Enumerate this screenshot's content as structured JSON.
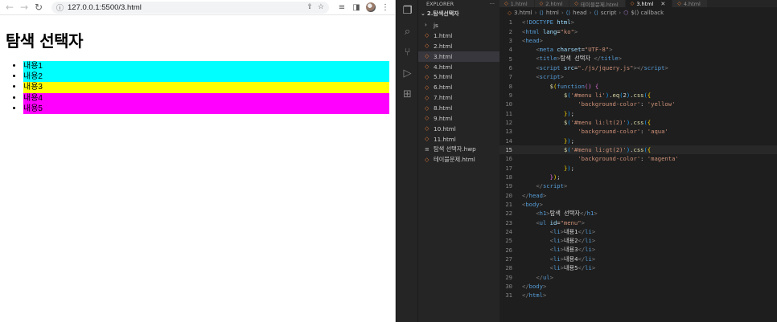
{
  "browser": {
    "url": "127.0.0.1:5500/3.html",
    "heading": "탐색 선택자",
    "items": [
      {
        "label": "내용1",
        "bg": "#00ffff"
      },
      {
        "label": "내용2",
        "bg": "#00ffff"
      },
      {
        "label": "내용3",
        "bg": "#ffff00"
      },
      {
        "label": "내용4",
        "bg": "#ff00ff"
      },
      {
        "label": "내용5",
        "bg": "#ff00ff"
      }
    ]
  },
  "explorer": {
    "header": "EXPLORER",
    "more": "···",
    "folder": "2.탐색선택자",
    "items": [
      {
        "label": "js",
        "kind": "dir"
      },
      {
        "label": "1.html",
        "kind": "html"
      },
      {
        "label": "2.html",
        "kind": "html"
      },
      {
        "label": "3.html",
        "kind": "html",
        "selected": true
      },
      {
        "label": "4.html",
        "kind": "html"
      },
      {
        "label": "5.html",
        "kind": "html"
      },
      {
        "label": "6.html",
        "kind": "html"
      },
      {
        "label": "7.html",
        "kind": "html"
      },
      {
        "label": "8.html",
        "kind": "html"
      },
      {
        "label": "9.html",
        "kind": "html"
      },
      {
        "label": "10.html",
        "kind": "html"
      },
      {
        "label": "11.html",
        "kind": "html"
      },
      {
        "label": "탐색 선택자.hwp",
        "kind": "txt"
      },
      {
        "label": "테이블문제.html",
        "kind": "html"
      }
    ]
  },
  "tabs": [
    {
      "label": "1.html",
      "active": false
    },
    {
      "label": "2.html",
      "active": false
    },
    {
      "label": "테이블문제.html",
      "active": false
    },
    {
      "label": "3.html",
      "active": true
    },
    {
      "label": "4.html",
      "active": false
    }
  ],
  "breadcrumb": [
    "3.html",
    "html",
    "head",
    "script",
    "$() callback"
  ],
  "code": [
    [
      [
        "t-brk",
        "<!"
      ],
      [
        "t-dt",
        "DOCTYPE"
      ],
      [
        "t-txt",
        " "
      ],
      [
        "t-attr",
        "html"
      ],
      [
        "t-brk",
        ">"
      ]
    ],
    [
      [
        "t-brk",
        "<"
      ],
      [
        "t-tag",
        "html"
      ],
      [
        "t-txt",
        " "
      ],
      [
        "t-attr",
        "lang"
      ],
      [
        "t-txt",
        "="
      ],
      [
        "t-str",
        "\"ko\""
      ],
      [
        "t-brk",
        ">"
      ]
    ],
    [
      [
        "t-brk",
        "<"
      ],
      [
        "t-tag",
        "head"
      ],
      [
        "t-brk",
        ">"
      ]
    ],
    [
      [
        "t-txt",
        "    "
      ],
      [
        "t-brk",
        "<"
      ],
      [
        "t-tag",
        "meta"
      ],
      [
        "t-txt",
        " "
      ],
      [
        "t-attr",
        "charset"
      ],
      [
        "t-txt",
        "="
      ],
      [
        "t-str",
        "\"UTF-8\""
      ],
      [
        "t-brk",
        ">"
      ]
    ],
    [
      [
        "t-txt",
        "    "
      ],
      [
        "t-brk",
        "<"
      ],
      [
        "t-tag",
        "title"
      ],
      [
        "t-brk",
        ">"
      ],
      [
        "t-txt",
        "탐색 선택자 "
      ],
      [
        "t-brk",
        "</"
      ],
      [
        "t-tag",
        "title"
      ],
      [
        "t-brk",
        ">"
      ]
    ],
    [
      [
        "t-txt",
        "    "
      ],
      [
        "t-brk",
        "<"
      ],
      [
        "t-tag",
        "script"
      ],
      [
        "t-txt",
        " "
      ],
      [
        "t-attr",
        "src"
      ],
      [
        "t-txt",
        "="
      ],
      [
        "t-str",
        "\"./js/jquery.js\""
      ],
      [
        "t-brk",
        "></"
      ],
      [
        "t-tag",
        "script"
      ],
      [
        "t-brk",
        ">"
      ]
    ],
    [
      [
        "t-txt",
        "    "
      ],
      [
        "t-brk",
        "<"
      ],
      [
        "t-tag",
        "script"
      ],
      [
        "t-brk",
        ">"
      ]
    ],
    [
      [
        "t-txt",
        "        "
      ],
      [
        "t-fn",
        "$"
      ],
      [
        "t-y",
        "("
      ],
      [
        "t-tag",
        "function"
      ],
      [
        "t-p",
        "()"
      ],
      [
        "t-txt",
        " "
      ],
      [
        "t-p",
        "{"
      ]
    ],
    [
      [
        "t-txt",
        "            "
      ],
      [
        "t-fn",
        "$"
      ],
      [
        "t-b",
        "("
      ],
      [
        "t-str",
        "'#menu li'"
      ],
      [
        "t-b",
        ")"
      ],
      [
        "t-txt",
        "."
      ],
      [
        "t-fn",
        "eq"
      ],
      [
        "t-b",
        "("
      ],
      [
        "t-txt",
        "2"
      ],
      [
        "t-b",
        ")"
      ],
      [
        "t-txt",
        "."
      ],
      [
        "t-fn",
        "css"
      ],
      [
        "t-b",
        "("
      ],
      [
        "t-y",
        "{"
      ]
    ],
    [
      [
        "t-txt",
        "                "
      ],
      [
        "t-str",
        "'background-color'"
      ],
      [
        "t-txt",
        ": "
      ],
      [
        "t-str",
        "'yellow'"
      ]
    ],
    [
      [
        "t-txt",
        "            "
      ],
      [
        "t-y",
        "}"
      ],
      [
        "t-b",
        ")"
      ],
      [
        "t-txt",
        ";"
      ]
    ],
    [
      [
        "t-txt",
        "            "
      ],
      [
        "t-fn",
        "$"
      ],
      [
        "t-b",
        "("
      ],
      [
        "t-str",
        "'#menu li:lt(2)'"
      ],
      [
        "t-b",
        ")"
      ],
      [
        "t-txt",
        "."
      ],
      [
        "t-fn",
        "css"
      ],
      [
        "t-b",
        "("
      ],
      [
        "t-y",
        "{"
      ]
    ],
    [
      [
        "t-txt",
        "                "
      ],
      [
        "t-str",
        "'background-color'"
      ],
      [
        "t-txt",
        ": "
      ],
      [
        "t-str",
        "'aqua'"
      ]
    ],
    [
      [
        "t-txt",
        "            "
      ],
      [
        "t-y",
        "}"
      ],
      [
        "t-b",
        ")"
      ],
      [
        "t-txt",
        ";"
      ]
    ],
    [
      [
        "t-txt",
        "            "
      ],
      [
        "t-fn",
        "$"
      ],
      [
        "t-b",
        "("
      ],
      [
        "t-str",
        "'#menu li:gt(2)'"
      ],
      [
        "t-b",
        ")"
      ],
      [
        "t-txt",
        "."
      ],
      [
        "t-fn",
        "css"
      ],
      [
        "t-b",
        "("
      ],
      [
        "t-y",
        "{"
      ]
    ],
    [
      [
        "t-txt",
        "                "
      ],
      [
        "t-str",
        "'background-color'"
      ],
      [
        "t-txt",
        ": "
      ],
      [
        "t-str",
        "'magenta'"
      ]
    ],
    [
      [
        "t-txt",
        "            "
      ],
      [
        "t-y",
        "}"
      ],
      [
        "t-b",
        ")"
      ],
      [
        "t-txt",
        ";"
      ]
    ],
    [
      [
        "t-txt",
        "        "
      ],
      [
        "t-p",
        "}"
      ],
      [
        "t-y",
        ")"
      ],
      [
        "t-txt",
        ";"
      ]
    ],
    [
      [
        "t-txt",
        "    "
      ],
      [
        "t-brk",
        "</"
      ],
      [
        "t-tag",
        "script"
      ],
      [
        "t-brk",
        ">"
      ]
    ],
    [
      [
        "t-brk",
        "</"
      ],
      [
        "t-tag",
        "head"
      ],
      [
        "t-brk",
        ">"
      ]
    ],
    [
      [
        "t-brk",
        "<"
      ],
      [
        "t-tag",
        "body"
      ],
      [
        "t-brk",
        ">"
      ]
    ],
    [
      [
        "t-txt",
        "    "
      ],
      [
        "t-brk",
        "<"
      ],
      [
        "t-tag",
        "h1"
      ],
      [
        "t-brk",
        ">"
      ],
      [
        "t-txt",
        "탐색 선택자"
      ],
      [
        "t-brk",
        "</"
      ],
      [
        "t-tag",
        "h1"
      ],
      [
        "t-brk",
        ">"
      ]
    ],
    [
      [
        "t-txt",
        "    "
      ],
      [
        "t-brk",
        "<"
      ],
      [
        "t-tag",
        "ul"
      ],
      [
        "t-txt",
        " "
      ],
      [
        "t-attr",
        "id"
      ],
      [
        "t-txt",
        "="
      ],
      [
        "t-str",
        "\"menu\""
      ],
      [
        "t-brk",
        ">"
      ]
    ],
    [
      [
        "t-txt",
        "        "
      ],
      [
        "t-brk",
        "<"
      ],
      [
        "t-tag",
        "li"
      ],
      [
        "t-brk",
        ">"
      ],
      [
        "t-txt",
        "내용1"
      ],
      [
        "t-brk",
        "</"
      ],
      [
        "t-tag",
        "li"
      ],
      [
        "t-brk",
        ">"
      ]
    ],
    [
      [
        "t-txt",
        "        "
      ],
      [
        "t-brk",
        "<"
      ],
      [
        "t-tag",
        "li"
      ],
      [
        "t-brk",
        ">"
      ],
      [
        "t-txt",
        "내용2"
      ],
      [
        "t-brk",
        "</"
      ],
      [
        "t-tag",
        "li"
      ],
      [
        "t-brk",
        ">"
      ]
    ],
    [
      [
        "t-txt",
        "        "
      ],
      [
        "t-brk",
        "<"
      ],
      [
        "t-tag",
        "li"
      ],
      [
        "t-brk",
        ">"
      ],
      [
        "t-txt",
        "내용3"
      ],
      [
        "t-brk",
        "</"
      ],
      [
        "t-tag",
        "li"
      ],
      [
        "t-brk",
        ">"
      ]
    ],
    [
      [
        "t-txt",
        "        "
      ],
      [
        "t-brk",
        "<"
      ],
      [
        "t-tag",
        "li"
      ],
      [
        "t-brk",
        ">"
      ],
      [
        "t-txt",
        "내용4"
      ],
      [
        "t-brk",
        "</"
      ],
      [
        "t-tag",
        "li"
      ],
      [
        "t-brk",
        ">"
      ]
    ],
    [
      [
        "t-txt",
        "        "
      ],
      [
        "t-brk",
        "<"
      ],
      [
        "t-tag",
        "li"
      ],
      [
        "t-brk",
        ">"
      ],
      [
        "t-txt",
        "내용5"
      ],
      [
        "t-brk",
        "</"
      ],
      [
        "t-tag",
        "li"
      ],
      [
        "t-brk",
        ">"
      ]
    ],
    [
      [
        "t-txt",
        "    "
      ],
      [
        "t-brk",
        "</"
      ],
      [
        "t-tag",
        "ul"
      ],
      [
        "t-brk",
        ">"
      ]
    ],
    [
      [
        "t-brk",
        "</"
      ],
      [
        "t-tag",
        "body"
      ],
      [
        "t-brk",
        ">"
      ]
    ],
    [
      [
        "t-brk",
        "</"
      ],
      [
        "t-tag",
        "html"
      ],
      [
        "t-brk",
        ">"
      ]
    ]
  ],
  "current_line": 15,
  "icons": {
    "back": "back-arrow-icon",
    "forward": "forward-arrow-icon",
    "reload": "reload-icon",
    "info": "site-info-icon"
  }
}
